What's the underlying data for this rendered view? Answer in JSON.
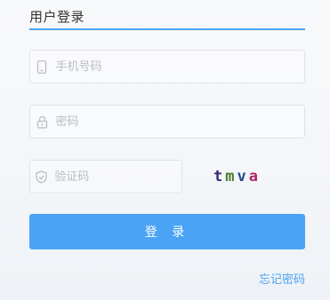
{
  "login": {
    "tab_title": "用户登录",
    "phone": {
      "placeholder": "手机号码",
      "value": "",
      "icon": "phone-icon"
    },
    "password": {
      "placeholder": "密码",
      "value": "",
      "icon": "lock-icon"
    },
    "captcha": {
      "placeholder": "验证码",
      "value": "",
      "icon": "shield-icon",
      "image_chars": [
        "t",
        "m",
        "v",
        "a"
      ],
      "image_colors": [
        "#3a2a6e",
        "#4a7a2a",
        "#2a4a8a",
        "#b0226a"
      ]
    },
    "submit_label": "登 录",
    "forgot_label": "忘记密码"
  },
  "colors": {
    "accent": "#4aa3f5",
    "border": "#dfe3e8",
    "placeholder": "#b8bec6"
  }
}
